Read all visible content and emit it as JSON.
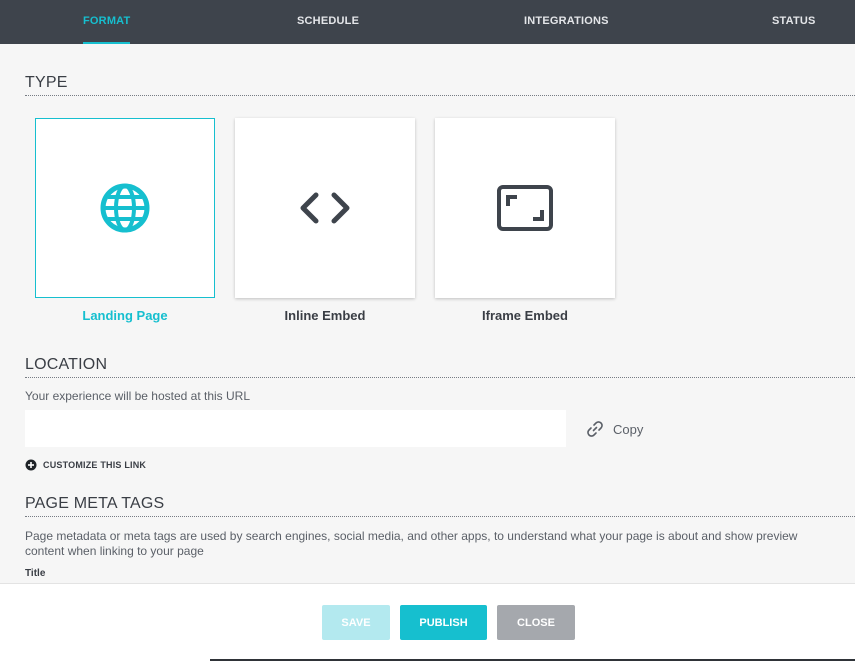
{
  "tabs": [
    {
      "label": "FORMAT",
      "active": true
    },
    {
      "label": "SCHEDULE",
      "active": false
    },
    {
      "label": "INTEGRATIONS",
      "active": false
    },
    {
      "label": "STATUS",
      "active": false
    }
  ],
  "type_section": {
    "title": "TYPE",
    "options": [
      {
        "label": "Landing Page",
        "icon": "globe-icon",
        "selected": true
      },
      {
        "label": "Inline Embed",
        "icon": "code-icon",
        "selected": false
      },
      {
        "label": "Iframe Embed",
        "icon": "frame-icon",
        "selected": false
      }
    ]
  },
  "location_section": {
    "title": "LOCATION",
    "helper": "Your experience will be hosted at this URL",
    "url_value": "",
    "copy_label": "Copy",
    "customize_label": "CUSTOMIZE THIS LINK"
  },
  "meta_section": {
    "title": "PAGE META TAGS",
    "helper": "Page metadata or meta tags are used by search engines, social media, and other apps, to understand what your page is about and show preview content when linking to your page",
    "title_field_label": "Title"
  },
  "footer": {
    "save_label": "SAVE",
    "publish_label": "PUBLISH",
    "close_label": "CLOSE"
  },
  "colors": {
    "accent": "#16bfcf",
    "nav_bg": "#3e444c",
    "icon_dark": "#3e444c"
  }
}
